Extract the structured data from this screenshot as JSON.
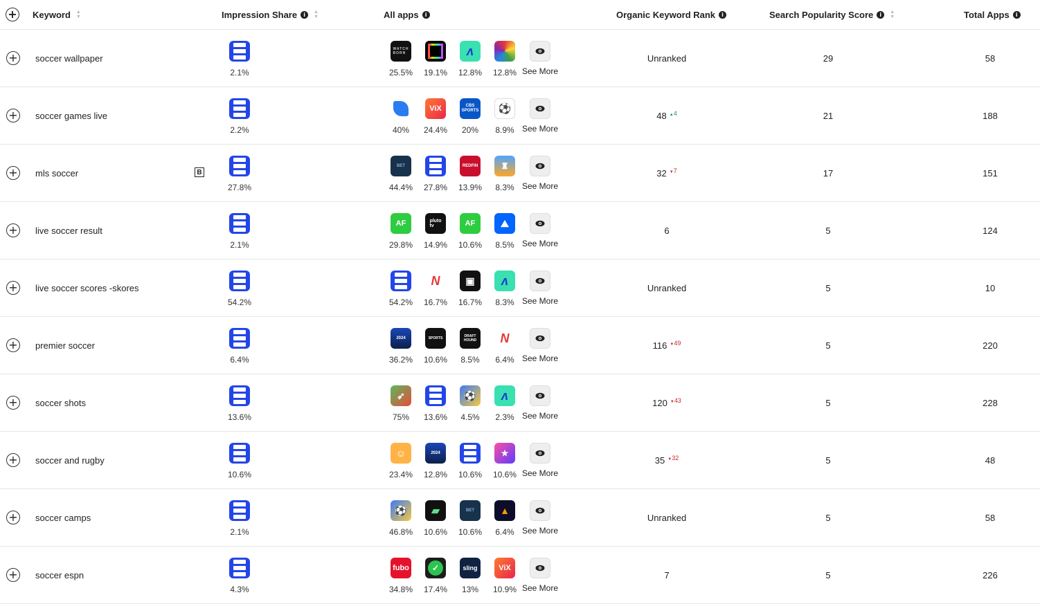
{
  "header": {
    "keyword": "Keyword",
    "impression_share": "Impression Share",
    "all_apps": "All apps",
    "organic_rank": "Organic Keyword Rank",
    "search_popularity": "Search Popularity Score",
    "total_apps": "Total Apps"
  },
  "see_more_label": "See More",
  "colors": {
    "brand": "#2346e8",
    "up": "#1a9a52",
    "down": "#c62828"
  },
  "rows": [
    {
      "keyword": "soccer wallpaper",
      "impression": "2.1%",
      "apps": [
        {
          "icon": "watch-born-icon",
          "share": "25.5%"
        },
        {
          "icon": "rainbow-square-icon",
          "share": "19.1%"
        },
        {
          "icon": "wave-a-icon",
          "share": "12.8%"
        },
        {
          "icon": "swirl-icon",
          "share": "12.8%"
        }
      ],
      "rank": "Unranked",
      "delta": "",
      "dir": "",
      "score": "29",
      "total": "58"
    },
    {
      "keyword": "soccer games live",
      "impression": "2.2%",
      "apps": [
        {
          "icon": "blue-shapes-icon",
          "share": "40%"
        },
        {
          "icon": "vix-icon",
          "share": "24.4%"
        },
        {
          "icon": "cbs-sports-icon",
          "share": "20%"
        },
        {
          "icon": "soccer-ball-icon",
          "share": "8.9%"
        }
      ],
      "rank": "48",
      "delta": "4",
      "dir": "up",
      "score": "21",
      "total": "188"
    },
    {
      "keyword": "mls soccer",
      "impression": "27.8%",
      "badge": "B",
      "apps": [
        {
          "icon": "bet-icon",
          "share": "44.4%"
        },
        {
          "icon": "brand-s-icon",
          "share": "27.8%"
        },
        {
          "icon": "redfin-icon",
          "share": "13.9%"
        },
        {
          "icon": "stadium-icon",
          "share": "8.3%"
        }
      ],
      "rank": "32",
      "delta": "7",
      "dir": "down",
      "score": "17",
      "total": "151"
    },
    {
      "keyword": "live soccer result",
      "impression": "2.1%",
      "apps": [
        {
          "icon": "af-tipo-icon",
          "share": "29.8%"
        },
        {
          "icon": "pluto-tv-icon",
          "share": "14.9%"
        },
        {
          "icon": "af-world-cup-icon",
          "share": "10.6%"
        },
        {
          "icon": "paramount-icon",
          "share": "8.5%"
        }
      ],
      "rank": "6",
      "delta": "",
      "dir": "",
      "score": "5",
      "total": "124"
    },
    {
      "keyword": "live soccer scores -skores",
      "impression": "54.2%",
      "apps": [
        {
          "icon": "brand-s-icon",
          "share": "54.2%"
        },
        {
          "icon": "red-n-icon",
          "share": "16.7%"
        },
        {
          "icon": "black-tv-icon",
          "share": "16.7%"
        },
        {
          "icon": "wave-a-icon",
          "share": "8.3%"
        }
      ],
      "rank": "Unranked",
      "delta": "",
      "dir": "",
      "score": "5",
      "total": "10"
    },
    {
      "keyword": "premier soccer",
      "impression": "6.4%",
      "apps": [
        {
          "icon": "players-2024-icon",
          "share": "36.2%"
        },
        {
          "icon": "sports-icon",
          "share": "10.6%"
        },
        {
          "icon": "draft-hound-icon",
          "share": "8.5%"
        },
        {
          "icon": "red-n-icon",
          "share": "6.4%"
        }
      ],
      "rank": "116",
      "delta": "49",
      "dir": "down",
      "score": "5",
      "total": "220"
    },
    {
      "keyword": "soccer shots",
      "impression": "13.6%",
      "apps": [
        {
          "icon": "archery-icon",
          "share": "75%"
        },
        {
          "icon": "brand-s-icon",
          "share": "13.6%"
        },
        {
          "icon": "runner-icon",
          "share": "4.5%"
        },
        {
          "icon": "wave-a-icon",
          "share": "2.3%"
        }
      ],
      "rank": "120",
      "delta": "43",
      "dir": "down",
      "score": "5",
      "total": "228"
    },
    {
      "keyword": "soccer and rugby",
      "impression": "10.6%",
      "apps": [
        {
          "icon": "player-cartoon-icon",
          "share": "23.4%"
        },
        {
          "icon": "players-2024-icon",
          "share": "12.8%"
        },
        {
          "icon": "brand-s-icon",
          "share": "10.6%"
        },
        {
          "icon": "rugby-stars-icon",
          "share": "10.6%"
        }
      ],
      "rank": "35",
      "delta": "32",
      "dir": "down",
      "score": "5",
      "total": "48"
    },
    {
      "keyword": "soccer camps",
      "impression": "2.1%",
      "apps": [
        {
          "icon": "runner-icon",
          "share": "46.8%"
        },
        {
          "icon": "green-stripes-icon",
          "share": "10.6%"
        },
        {
          "icon": "bet-icon",
          "share": "10.6%"
        },
        {
          "icon": "tower-icon",
          "share": "6.4%"
        }
      ],
      "rank": "Unranked",
      "delta": "",
      "dir": "",
      "score": "5",
      "total": "58"
    },
    {
      "keyword": "soccer espn",
      "impression": "4.3%",
      "apps": [
        {
          "icon": "fubo-icon",
          "share": "34.8%"
        },
        {
          "icon": "green-check-icon",
          "share": "17.4%"
        },
        {
          "icon": "sling-icon",
          "share": "13%"
        },
        {
          "icon": "vix-icon",
          "share": "10.9%"
        }
      ],
      "rank": "7",
      "delta": "",
      "dir": "",
      "score": "5",
      "total": "226"
    }
  ]
}
